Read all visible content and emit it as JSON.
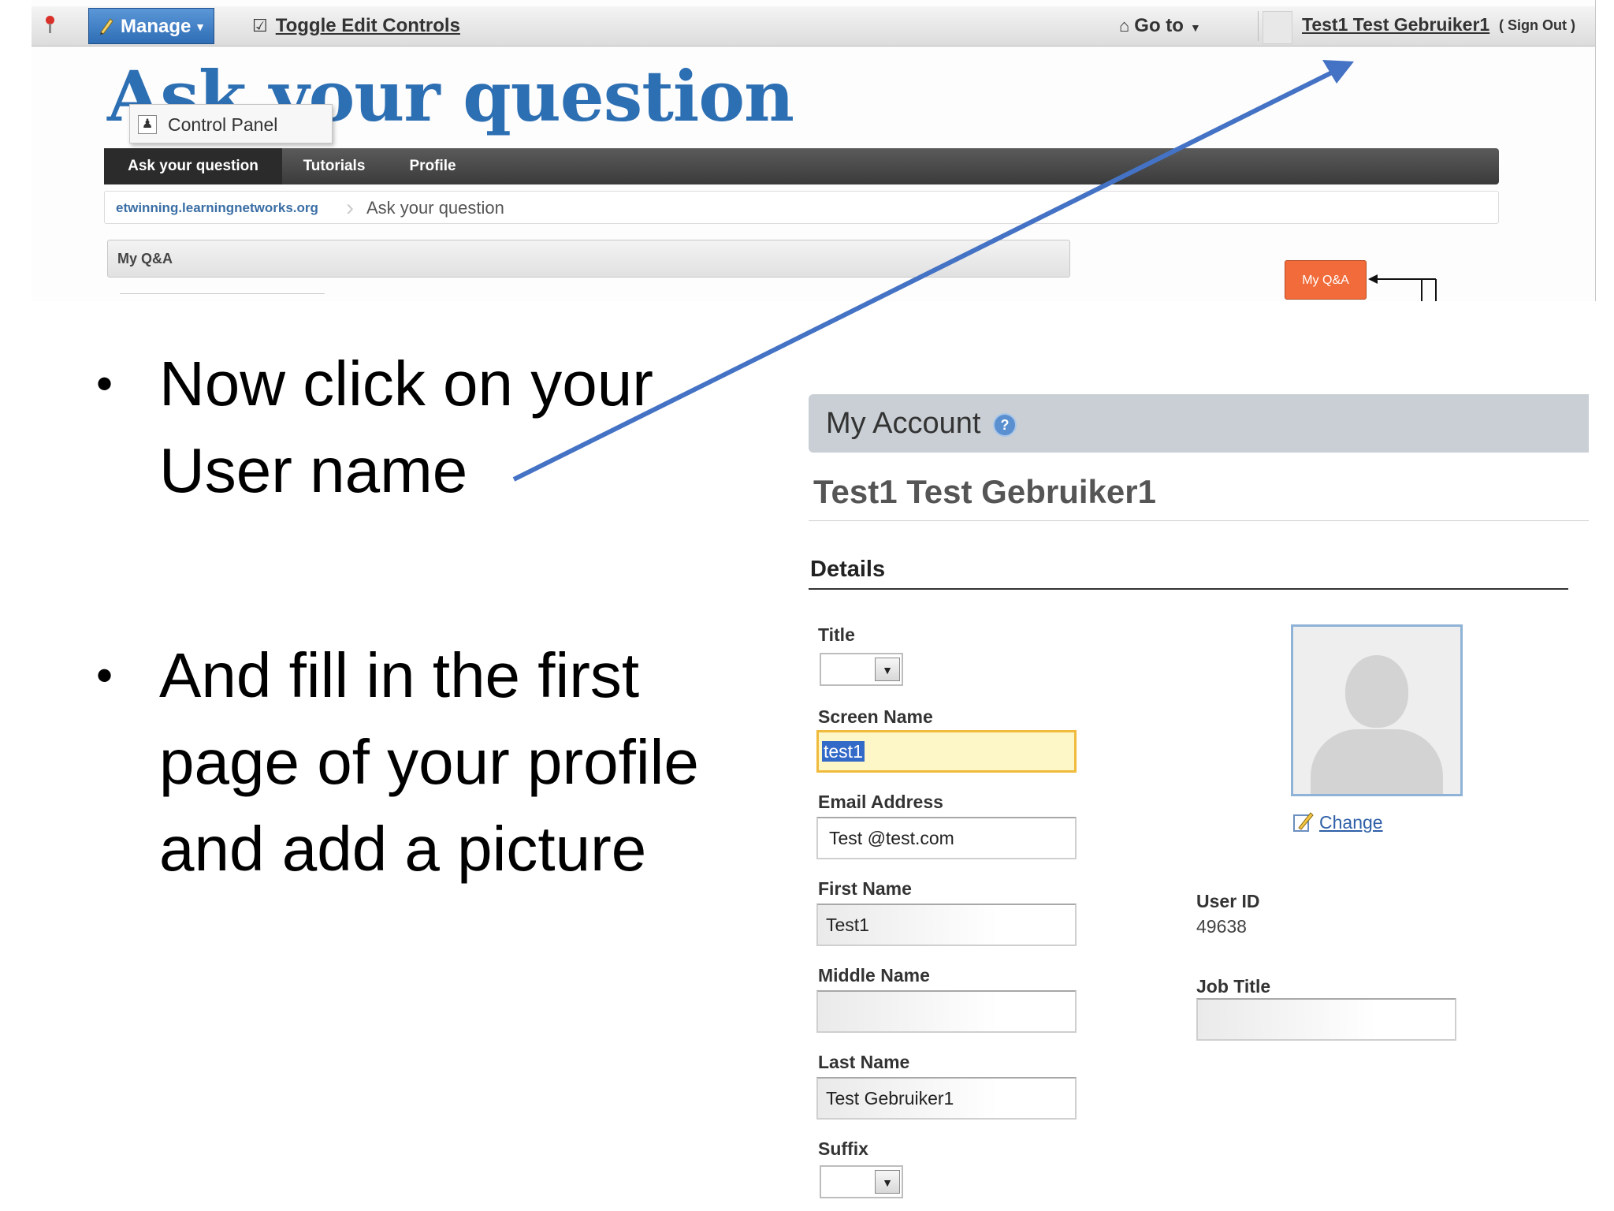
{
  "dockbar": {
    "manage_label": "Manage",
    "toggle_label": "Toggle Edit Controls",
    "goto_label": "Go to",
    "user_name": "Test1 Test Gebruiker1",
    "sign_out": "( Sign Out )"
  },
  "site": {
    "title": "Ask your question",
    "control_panel": "Control Panel",
    "nav": [
      "Ask your question",
      "Tutorials",
      "Profile"
    ],
    "breadcrumb_site": "etwinning.learningnetworks.org",
    "breadcrumb_current": "Ask your question",
    "qa_panel": "My Q&A",
    "qa_button": "My Q&A"
  },
  "bullets": [
    "Now click on your User name",
    "And fill in the first page of your profile and add a picture"
  ],
  "account": {
    "header": "My Account",
    "help_icon": "?",
    "full_name": "Test1 Test Gebruiker1",
    "details": "Details",
    "fields": {
      "title": "Title",
      "screen_name": "Screen Name",
      "screen_name_value": "test1",
      "email": "Email Address",
      "email_value": "Test @test.com",
      "first_name": "First Name",
      "first_name_value": "Test1",
      "middle_name": "Middle Name",
      "middle_name_value": "",
      "last_name": "Last Name",
      "last_name_value": "Test Gebruiker1",
      "suffix": "Suffix"
    },
    "change_label": "Change",
    "user_id_label": "User ID",
    "user_id_value": "49638",
    "job_title_label": "Job Title",
    "job_title_value": ""
  },
  "colors": {
    "arrow": "#4472c4",
    "title_blue": "#2d6fb3",
    "manage_blue": "#2f6db5",
    "focus_yellow": "#fdf6c6",
    "orange": "#f26b3a"
  },
  "icons": [
    "pushpin-icon",
    "pencil-icon",
    "checkbox-icon",
    "home-icon",
    "chevron-down-icon",
    "user-icon",
    "help-icon",
    "edit-icon",
    "arrow-icon"
  ]
}
